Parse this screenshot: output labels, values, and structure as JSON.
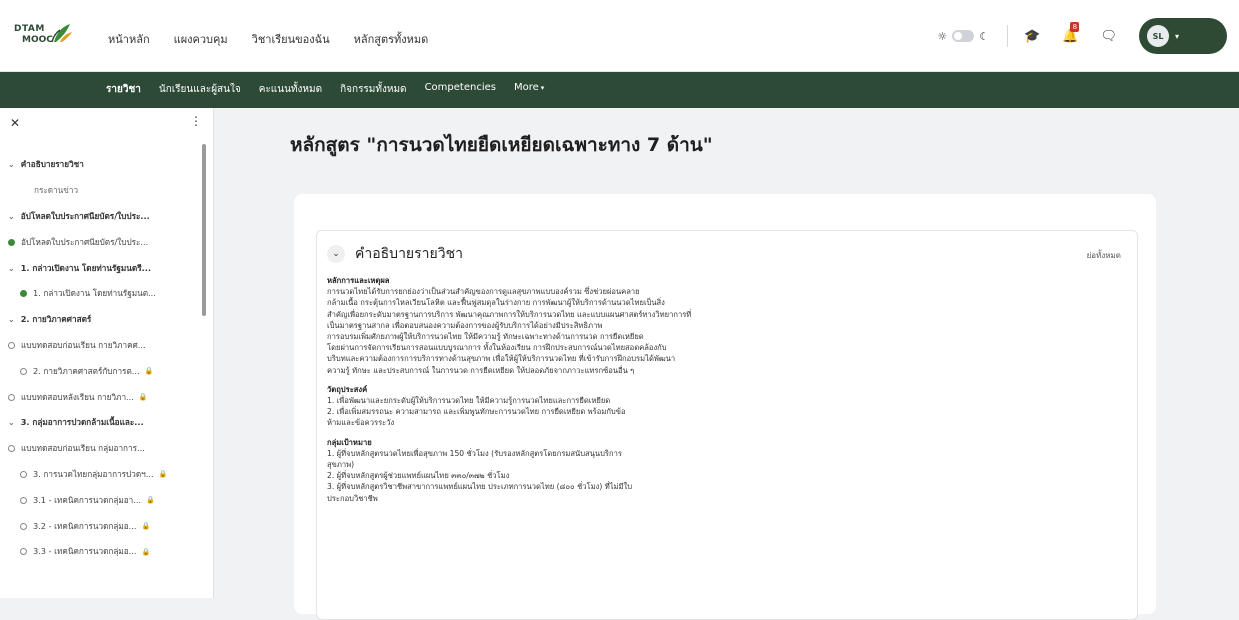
{
  "logo": {
    "line1": "DTAM",
    "line2": "MOOC"
  },
  "topnav": {
    "items": [
      "หน้าหลัก",
      "แผงควบคุม",
      "วิชาเรียนของฉัน",
      "หลักสูตรทั้งหมด"
    ]
  },
  "header": {
    "notif_count": "8",
    "user_initials": "SL"
  },
  "secnav": {
    "items": [
      "รายวิชา",
      "นักเรียนและผู้สนใจ",
      "คะแนนทั้งหมด",
      "กิจกรรมทั้งหมด",
      "Competencies",
      "More"
    ]
  },
  "sidebar": {
    "items": [
      {
        "label": "คำอธิบายรายวิชา",
        "kind": "section"
      },
      {
        "label": "กระดานข่าว",
        "kind": "plain"
      },
      {
        "label": "อัปโหลดใบประกาศนียบัตร/ใบประ...",
        "kind": "section"
      },
      {
        "label": "อัปโหลดใบประกาศนียบัตร/ใบประ...",
        "kind": "activity",
        "status": "filled",
        "level": 1
      },
      {
        "label": "1. กล่าวเปิดงาน โดยท่านรัฐมนตรี...",
        "kind": "section"
      },
      {
        "label": "1. กล่าวเปิดงาน โดยท่านรัฐมนต...",
        "kind": "activity",
        "status": "filled",
        "level": 2
      },
      {
        "label": "2. กายวิภาคศาสตร์",
        "kind": "section"
      },
      {
        "label": "แบบทดสอบก่อนเรียน กายวิภาคศ...",
        "kind": "activity",
        "status": "open",
        "level": 1
      },
      {
        "label": "2. กายวิภาคศาสตร์กับการต...",
        "kind": "activity",
        "status": "open",
        "level": 2,
        "locked": true
      },
      {
        "label": "แบบทดสอบหลังเรียน กายวิภา...",
        "kind": "activity",
        "status": "open",
        "level": 1,
        "locked": true
      },
      {
        "label": "3. กลุ่มอาการปวดกล้ามเนื้อและ...",
        "kind": "section"
      },
      {
        "label": "แบบทดสอบก่อนเรียน กลุ่มอาการ...",
        "kind": "activity",
        "status": "open",
        "level": 1
      },
      {
        "label": "3. การนวดไทยกลุ่มอาการปวดฯ...",
        "kind": "activity",
        "status": "open",
        "level": 2,
        "locked": true
      },
      {
        "label": "3.1 - เทคนิคการนวดกลุ่มอา...",
        "kind": "activity",
        "status": "open",
        "level": 2,
        "locked": true
      },
      {
        "label": "3.2 - เทคนิคการนวดกลุ่มอ...",
        "kind": "activity",
        "status": "open",
        "level": 2,
        "locked": true
      },
      {
        "label": "3.3 - เทคนิคการนวดกลุ่มอ...",
        "kind": "activity",
        "status": "open",
        "level": 2,
        "locked": true
      }
    ]
  },
  "main": {
    "title": "หลักสูตร \"การนวดไทยยืดเหยียดเฉพาะทาง 7 ด้าน\"",
    "section_title": "คำอธิบายรายวิชา",
    "collapse_all": "ย่อทั้งหมด",
    "blocks": [
      {
        "heading": "หลักการและเหตุผล",
        "lines": [
          "การนวดไทยได้รับการยกย่องว่าเป็นส่วนสำคัญของการดูแลสุขภาพแบบองค์รวม ซึ่งช่วยผ่อนคลาย",
          "กล้ามเนื้อ กระตุ้นการไหลเวียนโลหิต และฟื้นฟูสมดุลในร่างกาย การพัฒนาผู้ให้บริการด้านนวดไทยเป็นสิ่ง",
          "สำคัญเพื่อยกระดับมาตรฐานการบริการ พัฒนาคุณภาพการให้บริการนวดไทย และแบบแผนศาสตร์ทางวิทยาการที่",
          "เป็นมาตรฐานสากล เพื่อตอบสนองความต้องการของผู้รับบริการได้อย่างมีประสิทธิภาพ",
          "การอบรมเพิ่มศักยภาพผู้ให้บริการนวดไทย ให้มีความรู้ ทักษะเฉพาะทางด้านการนวด การยืดเหยียด",
          "โดยผ่านการจัดการเรียนการสอนแบบบูรณาการ ทั้งในห้องเรียน การฝึกประสบการณ์นวดไทยสอดคล้องกับ",
          "บริบทและความต้องการการบริการทางด้านสุขภาพ เพื่อให้ผู้ให้บริการนวดไทย ที่เข้ารับการฝึกอบรมได้พัฒนา",
          "ความรู้ ทักษะ และประสบการณ์ ในการนวด การยืดเหยียด ให้ปลอดภัยจากภาวะแทรกซ้อนอื่น ๆ"
        ]
      },
      {
        "heading": "วัตถุประสงค์",
        "lines": [
          "1. เพื่อพัฒนาและยกระดับผู้ให้บริการนวดไทย ให้มีความรู้การนวดไทยและการยืดเหยียด",
          "2. เพื่อเพิ่มสมรรถนะ ความสามารถ และเพิ่มพูนทักษะการนวดไทย การยืดเหยียด พร้อมกับข้อ",
          "ห้ามและข้อควรระวัง"
        ]
      },
      {
        "heading": "กลุ่มเป้าหมาย",
        "lines": [
          "1. ผู้ที่จบหลักสูตรนวดไทยเพื่อสุขภาพ 150 ชั่วโมง (รับรองหลักสูตรโดยกรมสนับสนุนบริการ",
          "สุขภาพ)",
          "2. ผู้ที่จบหลักสูตรผู้ช่วยแพทย์แผนไทย ๓๓๐/๓๗๒ ชั่วโมง",
          "3. ผู้ที่จบหลักสูตรวิชาชีพสาขาการแพทย์แผนไทย ประเภทการนวดไทย (๘๐๐ ชั่วโมง) ที่ไม่มีใบ",
          "ประกอบวิชาชีพ"
        ]
      }
    ]
  }
}
